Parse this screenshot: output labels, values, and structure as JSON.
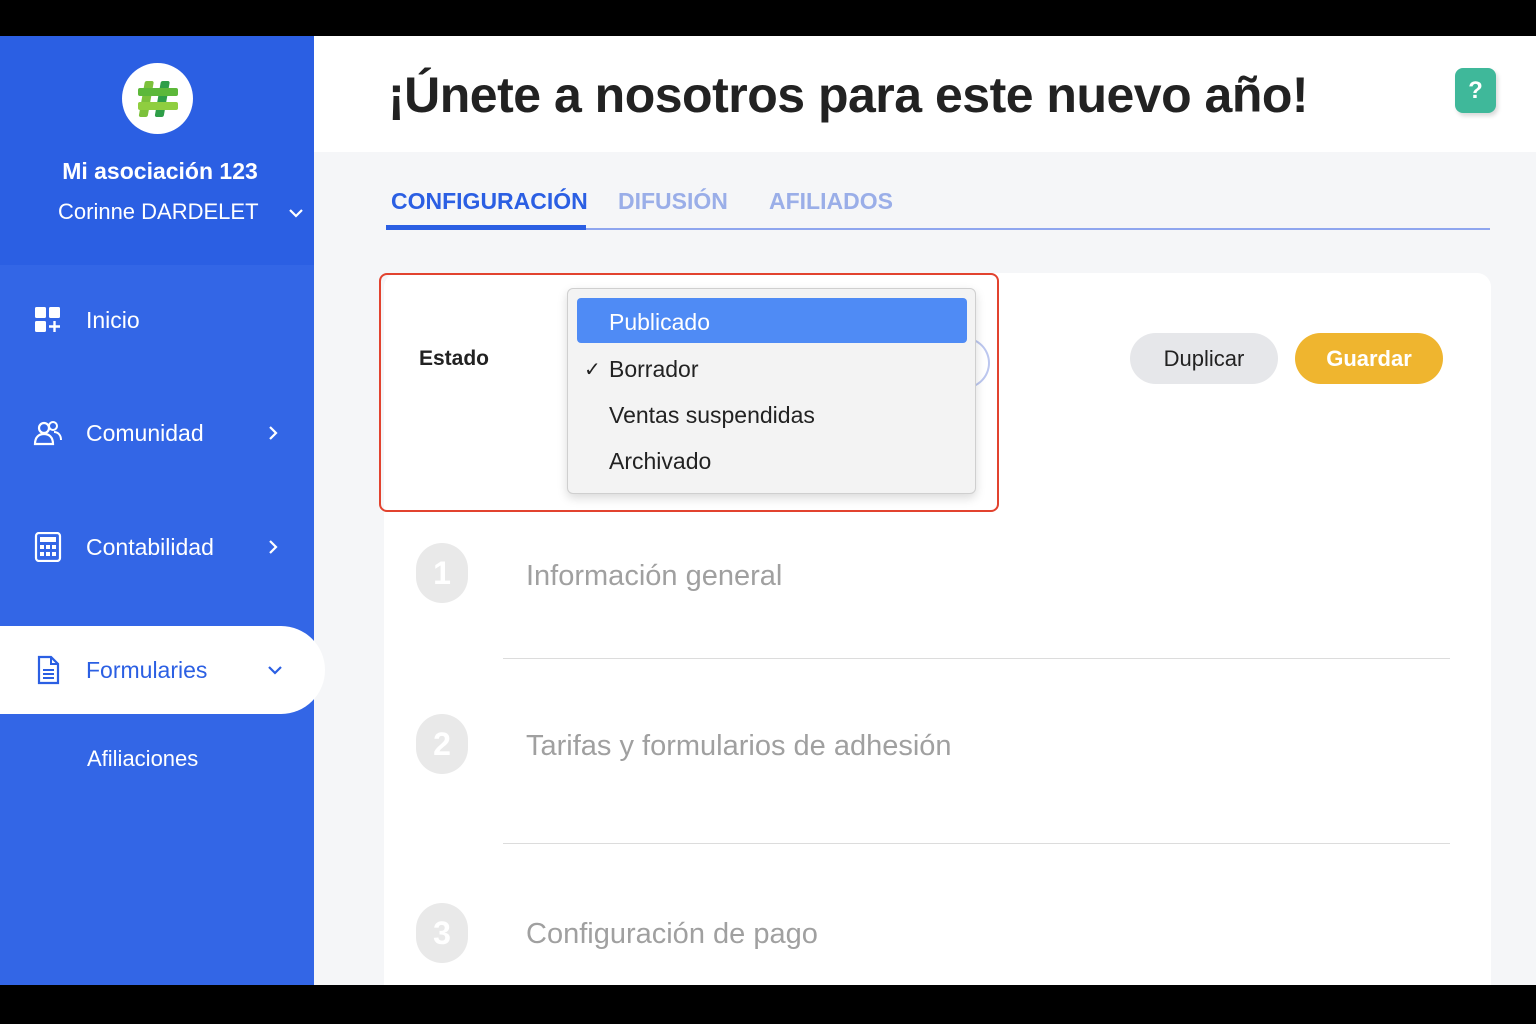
{
  "sidebar": {
    "org_name": "Mi asociación 123",
    "user_name": "Corinne DARDELET",
    "items": [
      {
        "label": "Inicio",
        "icon": "dashboard-icon"
      },
      {
        "label": "Comunidad",
        "icon": "users-icon"
      },
      {
        "label": "Contabilidad",
        "icon": "calculator-icon"
      },
      {
        "label": "Formularies",
        "icon": "document-icon"
      }
    ],
    "sub_items": [
      {
        "label": "Afiliaciones"
      }
    ]
  },
  "header": {
    "title": "¡Únete a nosotros para este nuevo año!",
    "help_label": "?"
  },
  "tabs": [
    {
      "label": "CONFIGURACIÓN",
      "active": true
    },
    {
      "label": "DIFUSIÓN",
      "active": false
    },
    {
      "label": "AFILIADOS",
      "active": false
    }
  ],
  "status": {
    "label": "Estado",
    "options": [
      "Publicado",
      "Borrador",
      "Ventas suspendidas",
      "Archivado"
    ],
    "selected": "Borrador",
    "highlighted": "Publicado",
    "check_mark": "✓"
  },
  "actions": {
    "duplicate_label": "Duplicar",
    "save_label": "Guardar"
  },
  "steps": [
    {
      "number": "1",
      "title": "Información general"
    },
    {
      "number": "2",
      "title": "Tarifas y formularios de adhesión"
    },
    {
      "number": "3",
      "title": "Configuración de pago"
    }
  ],
  "colors": {
    "sidebar": "#3366e6",
    "accent": "#2b5fe3",
    "save": "#efb52f",
    "help": "#3fb89a",
    "highlight_border": "#e2432f",
    "dropdown_hover": "#4f8bf5"
  }
}
